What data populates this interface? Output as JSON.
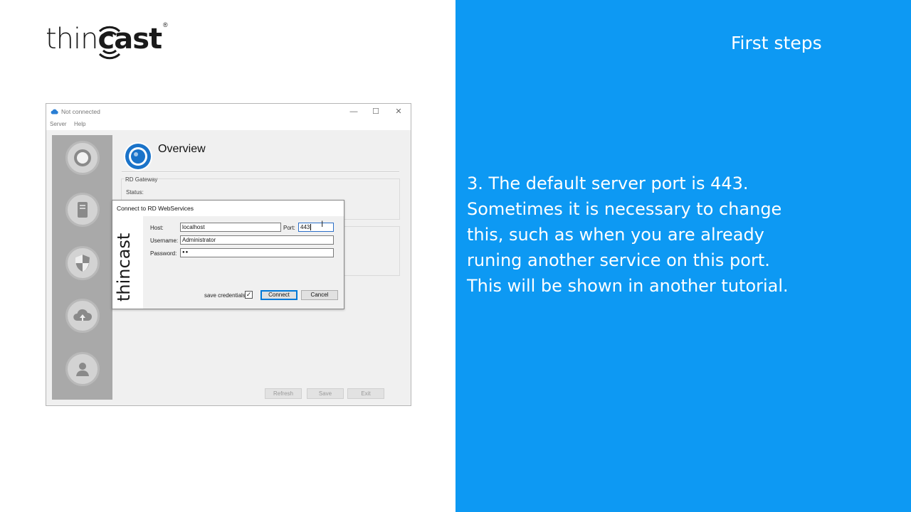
{
  "brand": {
    "logo_thin": "thin",
    "logo_cast": "cast",
    "registered": "®",
    "logo_color": "#1a1a1a"
  },
  "window": {
    "title": "Not connected",
    "controls": {
      "minimize": "—",
      "maximize": "☐",
      "close": "✕"
    },
    "menu": [
      "Server",
      "Help"
    ],
    "sidebar_icons": [
      "overview-icon",
      "server-icon",
      "security-icon",
      "cloud-icon",
      "users-icon"
    ],
    "overview_title": "Overview",
    "rd_gateway_label": "RD Gateway",
    "status_label": "Status:",
    "buttons": {
      "refresh": "Refresh",
      "save": "Save",
      "exit": "Exit"
    }
  },
  "dialog": {
    "title": "Connect to RD WebServices",
    "host_label": "Host:",
    "host_value": "localhost",
    "port_label": "Port:",
    "port_value": "443",
    "username_label": "Username:",
    "username_value": "Administrator",
    "password_label": "Password:",
    "password_value": "●●",
    "save_credentials_label": "save credentials",
    "save_credentials_checked": true,
    "check_mark": "✓",
    "connect_label": "Connect",
    "cancel_label": "Cancel",
    "logo_text": "thincast"
  },
  "slide": {
    "heading": "First steps",
    "lines": [
      "3. The default server port is 443.",
      "Sometimes it is necessary to change",
      "this, such as when you are already",
      "runing another service on this port.",
      "This will be shown in another tutorial."
    ],
    "background": "#0d99f3",
    "text_color": "#ffffff"
  }
}
